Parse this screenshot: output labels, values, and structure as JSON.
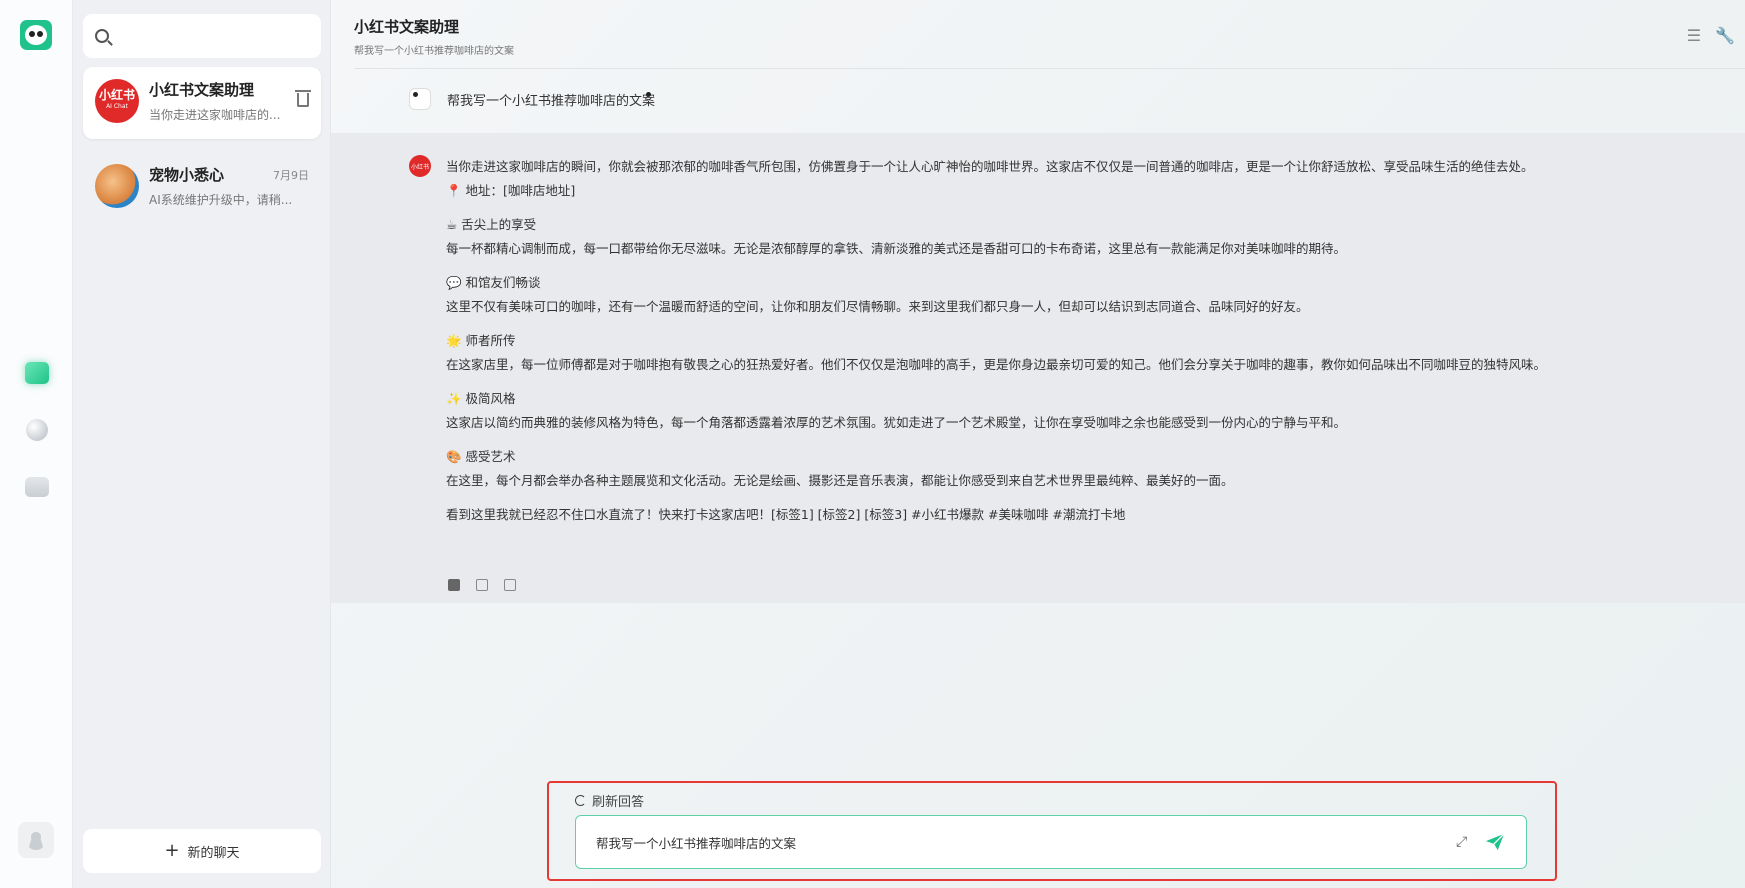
{
  "search": {
    "placeholder": ""
  },
  "conversations": [
    {
      "title": "小红书文案助理",
      "preview": "当你走进这家咖啡店的...",
      "date": "",
      "avatar_text": "小红书",
      "avatar_sub": "AI Chat"
    },
    {
      "title": "宠物小悉心",
      "preview": "AI系统维护升级中，请稍...",
      "date": "7月9日"
    }
  ],
  "new_chat_label": "新的聊天",
  "header": {
    "title": "小红书文案助理",
    "subtitle": "帮我写一个小红书推荐咖啡店的文案"
  },
  "user_message": "帮我写一个小红书推荐咖啡店的文案",
  "bot_avatar_text": "小红书",
  "bot_message": {
    "intro": "当你走进这家咖啡店的瞬间，你就会被那浓郁的咖啡香气所包围，仿佛置身于一个让人心旷神怡的咖啡世界。这家店不仅仅是一间普通的咖啡店，更是一个让你舒适放松、享受品味生活的绝佳去处。",
    "address": "📍 地址：[咖啡店地址]",
    "s1_title": "☕ 舌尖上的享受",
    "s1_body": "每一杯都精心调制而成，每一口都带给你无尽滋味。无论是浓郁醇厚的拿铁、清新淡雅的美式还是香甜可口的卡布奇诺，这里总有一款能满足你对美味咖啡的期待。",
    "s2_title": "💬 和馆友们畅谈",
    "s2_body": "这里不仅有美味可口的咖啡，还有一个温暖而舒适的空间，让你和朋友们尽情畅聊。来到这里我们都只身一人，但却可以结识到志同道合、品味同好的好友。",
    "s3_title": "🌟 师者所传",
    "s3_body": "在这家店里，每一位师傅都是对于咖啡抱有敬畏之心的狂热爱好者。他们不仅仅是泡咖啡的高手，更是你身边最亲切可爱的知己。他们会分享关于咖啡的趣事，教你如何品味出不同咖啡豆的独特风味。",
    "s4_title": "✨ 极简风格",
    "s4_body": "这家店以简约而典雅的装修风格为特色，每一个角落都透露着浓厚的艺术氛围。犹如走进了一个艺术殿堂，让你在享受咖啡之余也能感受到一份内心的宁静与平和。",
    "s5_title": "🎨 感受艺术",
    "s5_body": "在这里，每个月都会举办各种主题展览和文化活动。无论是绘画、摄影还是音乐表演，都能让你感受到来自艺术世界里最纯粹、最美好的一面。",
    "outro": "看到这里我就已经忍不住口水直流了！快来打卡这家店吧！[标签1] [标签2] [标签3] #小红书爆款 #美味咖啡 #潮流打卡地"
  },
  "refresh_label": "刷新回答",
  "input": {
    "value": "帮我写一个小红书推荐咖啡店的文案"
  },
  "colors": {
    "accent": "#1fc28a",
    "highlight_border": "#e53935",
    "brand_red": "#e02a2a"
  },
  "icons": [
    "search-icon",
    "trash-icon",
    "plus-icon",
    "panda-logo-icon",
    "chat-icon",
    "ball-icon",
    "robot-icon",
    "user-icon",
    "list-icon",
    "wrench-icon",
    "copy-icon",
    "edit-icon",
    "share-icon",
    "refresh-icon",
    "expand-icon",
    "send-icon"
  ]
}
